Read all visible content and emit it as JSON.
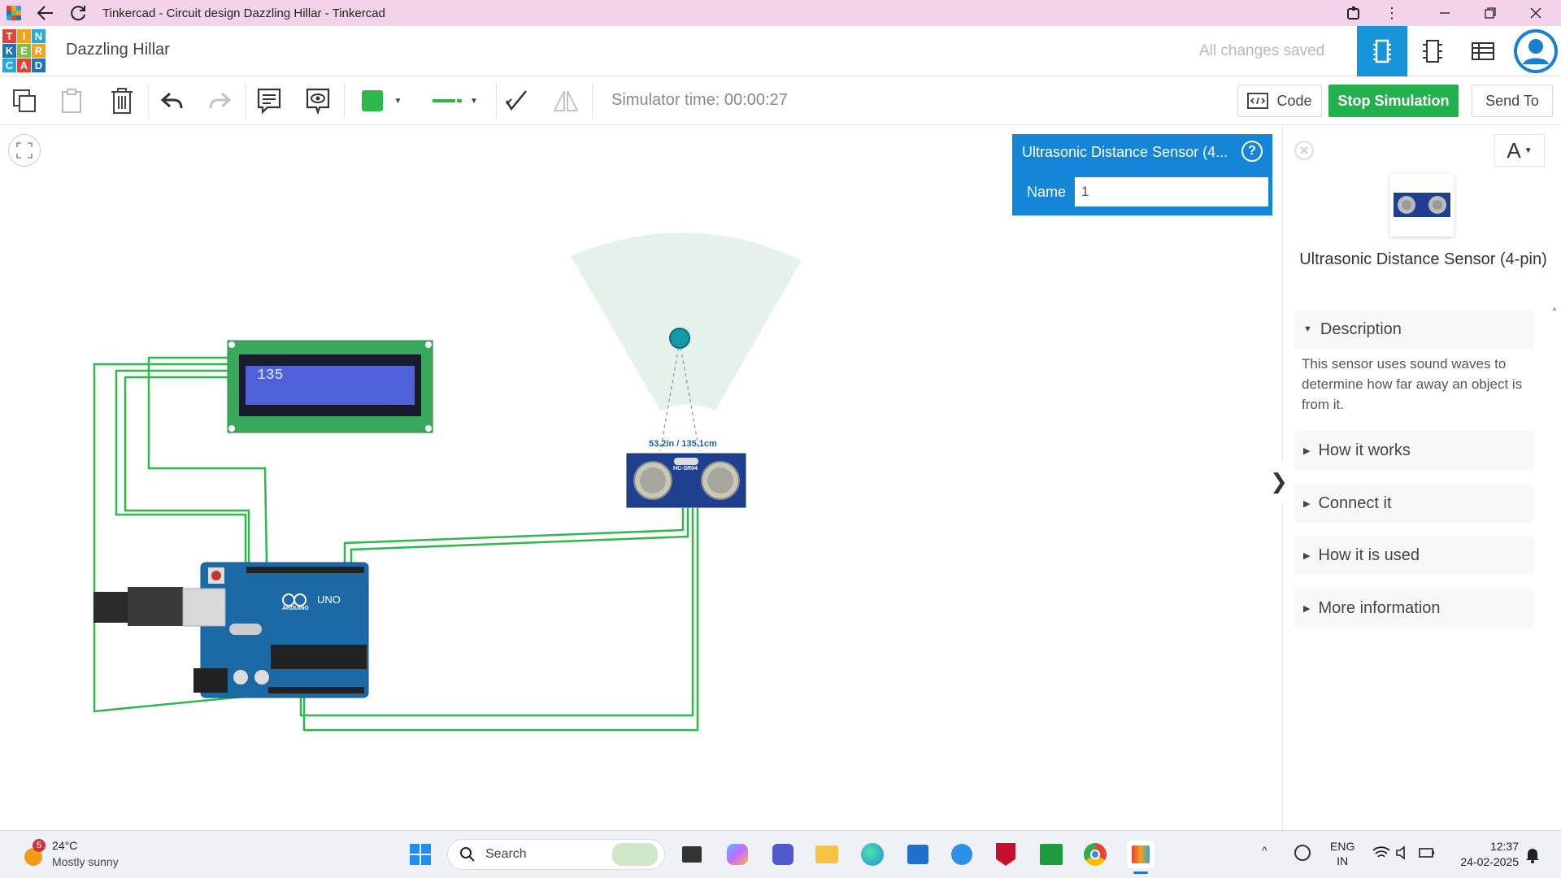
{
  "window": {
    "title": "Tinkercad - Circuit design Dazzling Hillar - Tinkercad"
  },
  "logo": {
    "letters": [
      "T",
      "I",
      "N",
      "K",
      "E",
      "R",
      "C",
      "A",
      "D"
    ],
    "colors": [
      "#e34234",
      "#f7a11a",
      "#25a9e0",
      "#1b75bc",
      "#7bc043",
      "#f7a11a",
      "#25a9e0",
      "#e34234",
      "#1b75bc"
    ]
  },
  "header": {
    "design_name": "Dazzling Hillar",
    "save_status": "All changes saved"
  },
  "toolbar": {
    "sim_time": "Simulator time: 00:00:27",
    "code_label": "Code",
    "stop_label": "Stop Simulation",
    "send_label": "Send To",
    "wire_color": "#2db84a"
  },
  "canvas": {
    "lcd_text": "135",
    "sensor_reading": "53.2in / 135.1cm",
    "sensor_chip": "HC-SR04",
    "arduino_model": "UNO",
    "arduino_brand": "ARDUINO"
  },
  "inspector": {
    "title": "Ultrasonic Distance Sensor (4...",
    "help": "?",
    "name_label": "Name",
    "name_value": "1"
  },
  "panel": {
    "font_button": "A",
    "component_title": "Ultrasonic Distance Sensor (4-pin)",
    "sections": [
      {
        "label": "Description",
        "expanded": true,
        "body": "This sensor uses sound waves to determine how far away an object is from it."
      },
      {
        "label": "How it works",
        "expanded": false
      },
      {
        "label": "Connect it",
        "expanded": false
      },
      {
        "label": "How it is used",
        "expanded": false
      },
      {
        "label": "More information",
        "expanded": false
      }
    ],
    "collapse_arrow": "❯"
  },
  "taskbar": {
    "weather_temp": "24°C",
    "weather_desc": "Mostly sunny",
    "weather_badge": "5",
    "search_label": "Search",
    "lang_top": "ENG",
    "lang_bottom": "IN",
    "time": "12:37",
    "date": "24-02-2025"
  }
}
